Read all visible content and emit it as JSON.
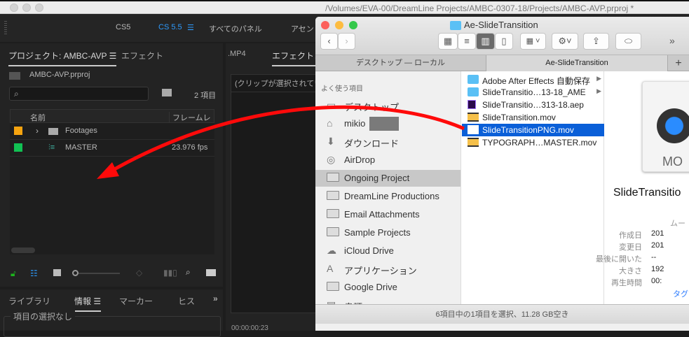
{
  "os": {
    "path": "/Volumes/EVA-00/DreamLine Projects/AMBC-0307-18/Projects/AMBC-AVP.prproj *"
  },
  "workspace": {
    "items": [
      "CS5",
      "CS 5.5",
      "すべてのパネル",
      "アセン"
    ],
    "accent": "#2d9cff"
  },
  "project": {
    "tab": "プロジェクト: AMBC-AVP",
    "tab2": "エフェクト",
    "file": "AMBC-AVP.prproj",
    "count": "2 項目",
    "col_name": "名前",
    "col_fps": "フレームレー",
    "rows": [
      {
        "name": "Footages",
        "fps": "",
        "color": "#f5a30f"
      },
      {
        "name": "MASTER",
        "fps": "23.976 fps",
        "color": "#11c153"
      }
    ]
  },
  "lower": {
    "tabs": [
      "ライブラリ",
      "情報",
      "マーカー",
      "ヒス"
    ],
    "more": "»",
    "info": "項目の選択なし"
  },
  "mid": {
    "tab1": ".MP4",
    "tab2": "エフェクトコ",
    "msg": "(クリップが選択されてい",
    "timecode": "00:00:00:23"
  },
  "finder": {
    "title": "Ae-SlideTransition",
    "tabs": [
      "デスクトップ — ローカル",
      "Ae-SlideTransition"
    ],
    "plus": "+",
    "more": "»",
    "sidebar_header": "よく使う項目",
    "sidebar": [
      {
        "label": "デスクトップ",
        "icon": "desktop-icon"
      },
      {
        "label": "mikio",
        "icon": "home-icon"
      },
      {
        "label": "ダウンロード",
        "icon": "download-icon"
      },
      {
        "label": "AirDrop",
        "icon": "airdrop-icon"
      },
      {
        "label": "Ongoing Project",
        "icon": "folder-icon",
        "selected": true
      },
      {
        "label": "DreamLine Productions",
        "icon": "folder-icon"
      },
      {
        "label": "Email Attachments",
        "icon": "folder-icon"
      },
      {
        "label": "Sample Projects",
        "icon": "folder-icon"
      },
      {
        "label": "iCloud Drive",
        "icon": "cloud-icon"
      },
      {
        "label": "アプリケーション",
        "icon": "applications-icon"
      },
      {
        "label": "Google Drive",
        "icon": "folder-icon"
      },
      {
        "label": "書類",
        "icon": "documents-icon"
      }
    ],
    "files": [
      {
        "name": "Adobe After Effects 自動保存",
        "type": "folder"
      },
      {
        "name": "SlideTransitio…13-18_AME",
        "type": "folder"
      },
      {
        "name": "SlideTransitio…313-18.aep",
        "type": "aep"
      },
      {
        "name": "SlideTransition.mov",
        "type": "mov"
      },
      {
        "name": "SlideTransitionPNG.mov",
        "type": "mov",
        "selected": true
      },
      {
        "name": "TYPOGRAPH…MASTER.mov",
        "type": "mov"
      }
    ],
    "preview": {
      "badge": "MO",
      "name": "SlideTransitio",
      "kind": "ムー",
      "meta": [
        {
          "k": "作成日",
          "v": "201"
        },
        {
          "k": "変更日",
          "v": "201"
        },
        {
          "k": "最後に開いた",
          "v": "--"
        },
        {
          "k": "大きさ",
          "v": "192"
        },
        {
          "k": "再生時間",
          "v": "00:"
        }
      ],
      "tags": "タグ"
    },
    "status": "6項目中の1項目を選択、11.28 GB空き"
  }
}
